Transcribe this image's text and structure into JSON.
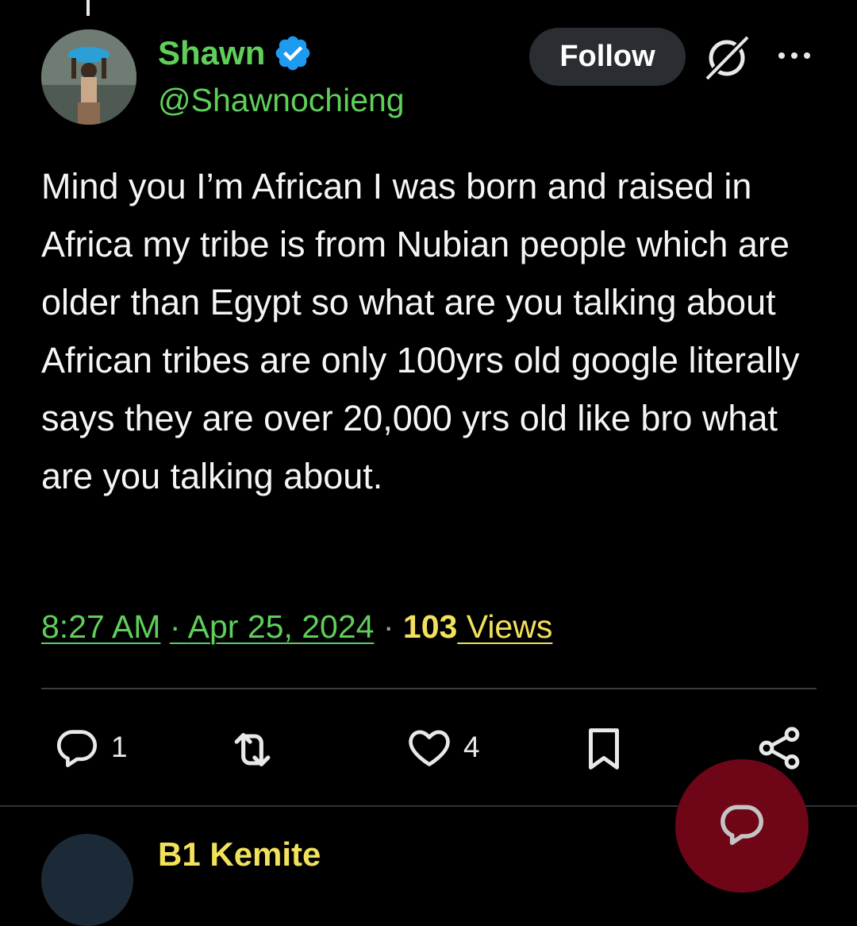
{
  "author": {
    "display_name": "Shawn",
    "handle": "@Shawnochieng",
    "verified": true
  },
  "actions": {
    "follow_label": "Follow"
  },
  "tweet": {
    "text": "Mind you I’m African I was born and raised in Africa my tribe is from Nubian people which are older than Egypt so what are you talking about African tribes are only 100yrs old google literally says they are over 20,000 yrs old like bro what are you talking about.",
    "time": "8:27 AM",
    "separator": "·",
    "date": "Apr 25, 2024",
    "views_count": "103",
    "views_label": " Views"
  },
  "engagement": {
    "replies": "1",
    "likes": "4"
  },
  "next_reply": {
    "display_name": "B1 Kemite"
  },
  "colors": {
    "background": "#000000",
    "name_green": "#5fcf5a",
    "verified_blue": "#1d9bf0",
    "views_yellow": "#f2e15c",
    "follow_button_bg": "#2a2e33",
    "fab_maroon": "#6e0618"
  },
  "icons": {
    "verified": "verified-badge-icon",
    "grok": "grok-icon",
    "more": "more-icon",
    "reply": "reply-icon",
    "repost": "repost-icon",
    "like": "heart-icon",
    "bookmark": "bookmark-icon",
    "share": "share-icon",
    "compose_reply": "compose-reply-icon"
  }
}
